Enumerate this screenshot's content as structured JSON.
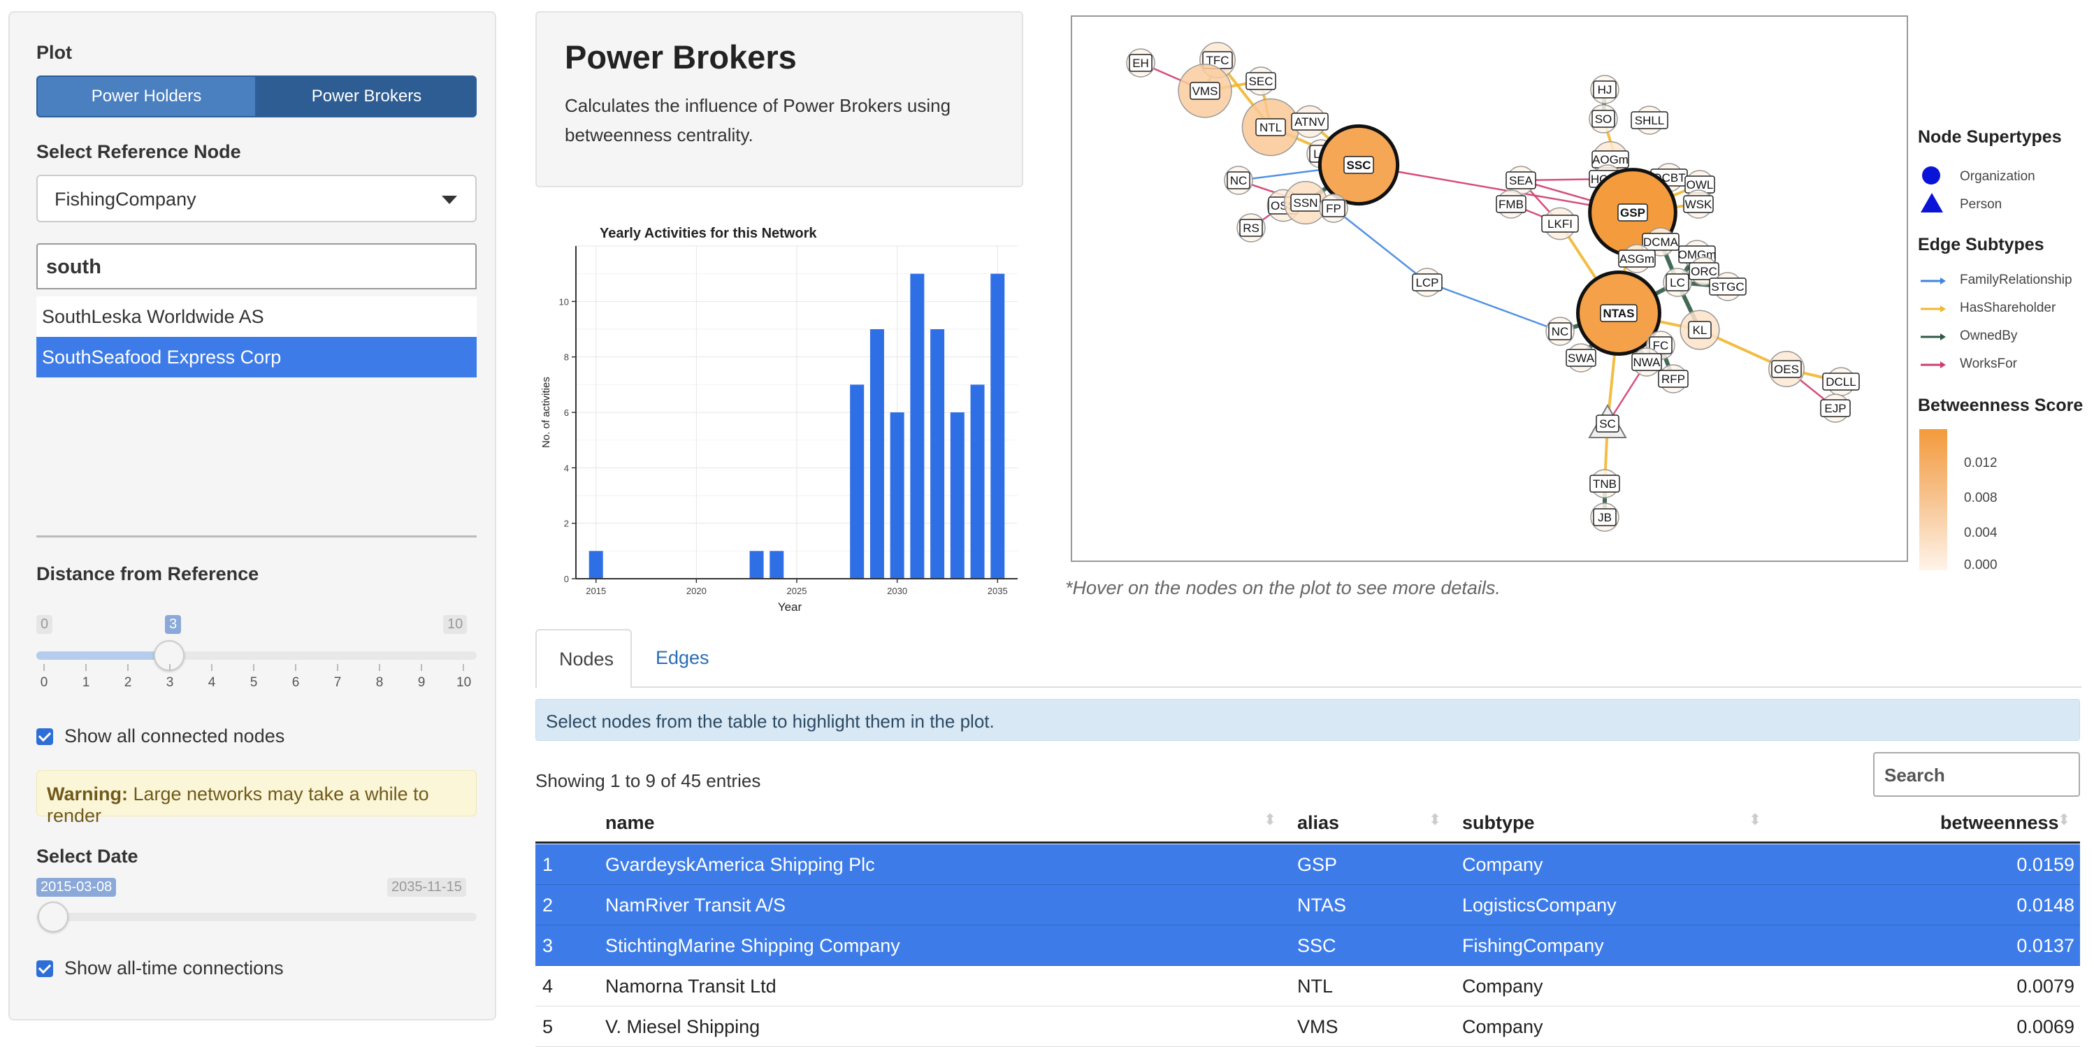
{
  "sidebar": {
    "plot_label": "Plot",
    "plot_buttons": [
      "Power Holders",
      "Power Brokers"
    ],
    "ref_label": "Select Reference Node",
    "ref_value": "FishingCompany",
    "search_value": "south",
    "options": [
      "SouthLeska Worldwide AS",
      "SouthSeafood Express Corp"
    ],
    "distance_label": "Distance from Reference",
    "distance": {
      "min": "0",
      "max": "10",
      "value": "3",
      "value_num": 3,
      "ticks": [
        "0",
        "1",
        "2",
        "3",
        "4",
        "5",
        "6",
        "7",
        "8",
        "9",
        "10"
      ]
    },
    "show_connected": "Show all connected nodes",
    "warning_bold": "Warning:",
    "warning_text": " Large networks may take a while to render",
    "date_label": "Select Date",
    "date": {
      "min": "2015-03-08",
      "max": "2035-11-15"
    },
    "show_alltime": "Show all-time connections"
  },
  "header": {
    "title": "Power Brokers",
    "description": "Calculates the influence of Power Brokers using betweenness centrality."
  },
  "chart_data": {
    "type": "bar",
    "title": "Yearly Activities for this Network",
    "xlabel": "Year",
    "ylabel": "No. of activities",
    "x": [
      2015,
      2023,
      2024,
      2028,
      2029,
      2030,
      2031,
      2032,
      2033,
      2034,
      2035
    ],
    "values": [
      1,
      1,
      1,
      7,
      9,
      6,
      11,
      9,
      6,
      7,
      11
    ],
    "xlim": [
      2014,
      2036
    ],
    "ylim": [
      0,
      12
    ],
    "xticks": [
      "2015",
      "2020",
      "2025",
      "2030",
      "2035"
    ],
    "yticks": [
      "0",
      "2",
      "4",
      "6",
      "8",
      "10"
    ],
    "color": "#2f6fe6"
  },
  "network": {
    "nodes": [
      {
        "id": "EH",
        "shape": "circle",
        "score": 0
      },
      {
        "id": "TFC",
        "shape": "circle",
        "score": 0.002
      },
      {
        "id": "SEC",
        "shape": "circle",
        "score": 0
      },
      {
        "id": "VMS",
        "shape": "circle",
        "score": 0.0069
      },
      {
        "id": "NTL",
        "shape": "circle",
        "score": 0.0079
      },
      {
        "id": "ATNV",
        "shape": "circle",
        "score": 0.001
      },
      {
        "id": "LC",
        "shape": "circle",
        "score": 0
      },
      {
        "id": "SSC",
        "shape": "circle",
        "score": 0.0137
      },
      {
        "id": "NC",
        "shape": "circle",
        "score": 0
      },
      {
        "id": "OSS",
        "shape": "circle",
        "score": 0.001
      },
      {
        "id": "SSN",
        "shape": "circle",
        "score": 0.004
      },
      {
        "id": "FP",
        "shape": "circle",
        "score": 0
      },
      {
        "id": "RS",
        "shape": "circle",
        "score": 0
      },
      {
        "id": "LCP",
        "shape": "circle",
        "score": 0
      },
      {
        "id": "HJ",
        "shape": "circle",
        "score": 0
      },
      {
        "id": "SO",
        "shape": "circle",
        "score": 0
      },
      {
        "id": "SHLL",
        "shape": "circle",
        "score": 0
      },
      {
        "id": "AOGm",
        "shape": "circle",
        "score": 0.002
      },
      {
        "id": "SEA",
        "shape": "circle",
        "score": 0
      },
      {
        "id": "HCNV",
        "shape": "circle",
        "score": 0
      },
      {
        "id": "OCBT",
        "shape": "circle",
        "score": 0
      },
      {
        "id": "OWL",
        "shape": "circle",
        "score": 0
      },
      {
        "id": "FMB",
        "shape": "circle",
        "score": 0
      },
      {
        "id": "GSP",
        "shape": "circle",
        "score": 0.0159
      },
      {
        "id": "WSK",
        "shape": "circle",
        "score": 0
      },
      {
        "id": "LKFI",
        "shape": "circle",
        "score": 0.001
      },
      {
        "id": "DCMA",
        "shape": "circle",
        "score": 0
      },
      {
        "id": "ASGm",
        "shape": "circle",
        "score": 0
      },
      {
        "id": "OMGm",
        "shape": "circle",
        "score": 0
      },
      {
        "id": "LC2",
        "label": "LC",
        "shape": "circle",
        "score": 0
      },
      {
        "id": "ORC",
        "shape": "circle",
        "score": 0
      },
      {
        "id": "STGC",
        "shape": "circle",
        "score": 0
      },
      {
        "id": "NTAS",
        "shape": "circle",
        "score": 0.0148
      },
      {
        "id": "KL",
        "shape": "circle",
        "score": 0.003
      },
      {
        "id": "NC2",
        "label": "NC",
        "shape": "circle",
        "score": 0
      },
      {
        "id": "FC",
        "shape": "circle",
        "score": 0
      },
      {
        "id": "SWA",
        "shape": "circle",
        "score": 0
      },
      {
        "id": "NWA",
        "shape": "circle",
        "score": 0
      },
      {
        "id": "RFP",
        "shape": "circle",
        "score": 0
      },
      {
        "id": "OES",
        "shape": "circle",
        "score": 0.002
      },
      {
        "id": "DCLL",
        "shape": "circle",
        "score": 0
      },
      {
        "id": "EJP",
        "shape": "circle",
        "score": 0
      },
      {
        "id": "SC",
        "shape": "triangle",
        "score": 0
      },
      {
        "id": "TNB",
        "shape": "circle",
        "score": 0
      },
      {
        "id": "JB",
        "shape": "circle",
        "score": 0
      }
    ],
    "edges": [
      [
        "EH",
        "VMS",
        "WorksFor"
      ],
      [
        "TFC",
        "VMS",
        "HasShareholder"
      ],
      [
        "SEC",
        "VMS",
        "HasShareholder"
      ],
      [
        "TFC",
        "NTL",
        "HasShareholder"
      ],
      [
        "SEC",
        "NTL",
        "HasShareholder"
      ],
      [
        "NTL",
        "SSC",
        "HasShareholder"
      ],
      [
        "ATNV",
        "SSC",
        "HasShareholder"
      ],
      [
        "LC",
        "SSC",
        "OwnedBy"
      ],
      [
        "NC",
        "SSC",
        "FamilyRelationship"
      ],
      [
        "NC",
        "SSN",
        "WorksFor"
      ],
      [
        "OSS",
        "SSN",
        "HasShareholder"
      ],
      [
        "SSN",
        "SSC",
        "OwnedBy"
      ],
      [
        "FP",
        "SSC",
        "OwnedBy"
      ],
      [
        "RS",
        "OSS",
        "WorksFor"
      ],
      [
        "FP",
        "LCP",
        "FamilyRelationship"
      ],
      [
        "LCP",
        "NC2",
        "FamilyRelationship"
      ],
      [
        "SSC",
        "GSP",
        "WorksFor"
      ],
      [
        "HJ",
        "SO",
        "OwnedBy"
      ],
      [
        "SO",
        "GSP",
        "HasShareholder"
      ],
      [
        "AOGm",
        "GSP",
        "HasShareholder"
      ],
      [
        "SEA",
        "GSP",
        "WorksFor"
      ],
      [
        "SEA",
        "HCNV",
        "WorksFor"
      ],
      [
        "SEA",
        "LKFI",
        "WorksFor"
      ],
      [
        "FMB",
        "LKFI",
        "WorksFor"
      ],
      [
        "OCBT",
        "GSP",
        "HasShareholder"
      ],
      [
        "OWL",
        "GSP",
        "HasShareholder"
      ],
      [
        "WSK",
        "GSP",
        "HasShareholder"
      ],
      [
        "HCNV",
        "GSP",
        "WorksFor"
      ],
      [
        "DCMA",
        "GSP",
        "OwnedBy"
      ],
      [
        "ASGm",
        "GSP",
        "HasShareholder"
      ],
      [
        "DCMA",
        "LC2",
        "OwnedBy"
      ],
      [
        "OMGm",
        "LC2",
        "OwnedBy"
      ],
      [
        "ORC",
        "LC2",
        "OwnedBy"
      ],
      [
        "STGC",
        "LC2",
        "OwnedBy"
      ],
      [
        "LC2",
        "KL",
        "OwnedBy"
      ],
      [
        "LKFI",
        "NTAS",
        "HasShareholder"
      ],
      [
        "GSP",
        "NTAS",
        "HasShareholder"
      ],
      [
        "NC2",
        "NTAS",
        "OwnedBy"
      ],
      [
        "SWA",
        "NTAS",
        "OwnedBy"
      ],
      [
        "FC",
        "NTAS",
        "OwnedBy"
      ],
      [
        "NWA",
        "NTAS",
        "OwnedBy"
      ],
      [
        "RFP",
        "FC",
        "OwnedBy"
      ],
      [
        "NTAS",
        "KL",
        "HasShareholder"
      ],
      [
        "KL",
        "OES",
        "HasShareholder"
      ],
      [
        "OES",
        "DCLL",
        "HasShareholder"
      ],
      [
        "OES",
        "EJP",
        "WorksFor"
      ],
      [
        "NTAS",
        "SC",
        "HasShareholder"
      ],
      [
        "SC",
        "TNB",
        "HasShareholder"
      ],
      [
        "TNB",
        "JB",
        "OwnedBy"
      ],
      [
        "NWA",
        "SC",
        "WorksFor"
      ],
      [
        "LC2",
        "NTAS",
        "OwnedBy"
      ]
    ],
    "edge_colors": {
      "FamilyRelationship": "#3e86e0",
      "HasShareholder": "#f2b630",
      "OwnedBy": "#2e5a44",
      "WorksFor": "#d23c6d"
    }
  },
  "hover_note": "*Hover on the nodes on the plot to see more details.",
  "legend": {
    "supertypes_title": "Node Supertypes",
    "supertypes": [
      "Organization",
      "Person"
    ],
    "edge_title": "Edge Subtypes",
    "edges": [
      {
        "label": "FamilyRelationship",
        "color": "#3e86e0"
      },
      {
        "label": "HasShareholder",
        "color": "#f2b630"
      },
      {
        "label": "OwnedBy",
        "color": "#2e5a44"
      },
      {
        "label": "WorksFor",
        "color": "#d23c6d"
      }
    ],
    "score_title": "Betweenness Score",
    "score_ticks": [
      "0.012",
      "0.008",
      "0.004",
      "0.000"
    ]
  },
  "tabs": [
    "Nodes",
    "Edges"
  ],
  "info": "Select nodes from the table to highlight them in the plot.",
  "table": {
    "showing": "Showing 1 to 9 of 45 entries",
    "search_placeholder": "Search",
    "headers": [
      "name",
      "alias",
      "subtype",
      "betweenness"
    ],
    "rows": [
      {
        "n": "1",
        "name": "GvardeyskAmerica Shipping Plc",
        "alias": "GSP",
        "subtype": "Company",
        "b": "0.0159",
        "selected": true
      },
      {
        "n": "2",
        "name": "NamRiver Transit A/S",
        "alias": "NTAS",
        "subtype": "LogisticsCompany",
        "b": "0.0148",
        "selected": true
      },
      {
        "n": "3",
        "name": "StichtingMarine Shipping Company",
        "alias": "SSC",
        "subtype": "FishingCompany",
        "b": "0.0137",
        "selected": true
      },
      {
        "n": "4",
        "name": "Namorna Transit Ltd",
        "alias": "NTL",
        "subtype": "Company",
        "b": "0.0079",
        "selected": false
      },
      {
        "n": "5",
        "name": "V. Miesel Shipping",
        "alias": "VMS",
        "subtype": "Company",
        "b": "0.0069",
        "selected": false
      }
    ]
  }
}
